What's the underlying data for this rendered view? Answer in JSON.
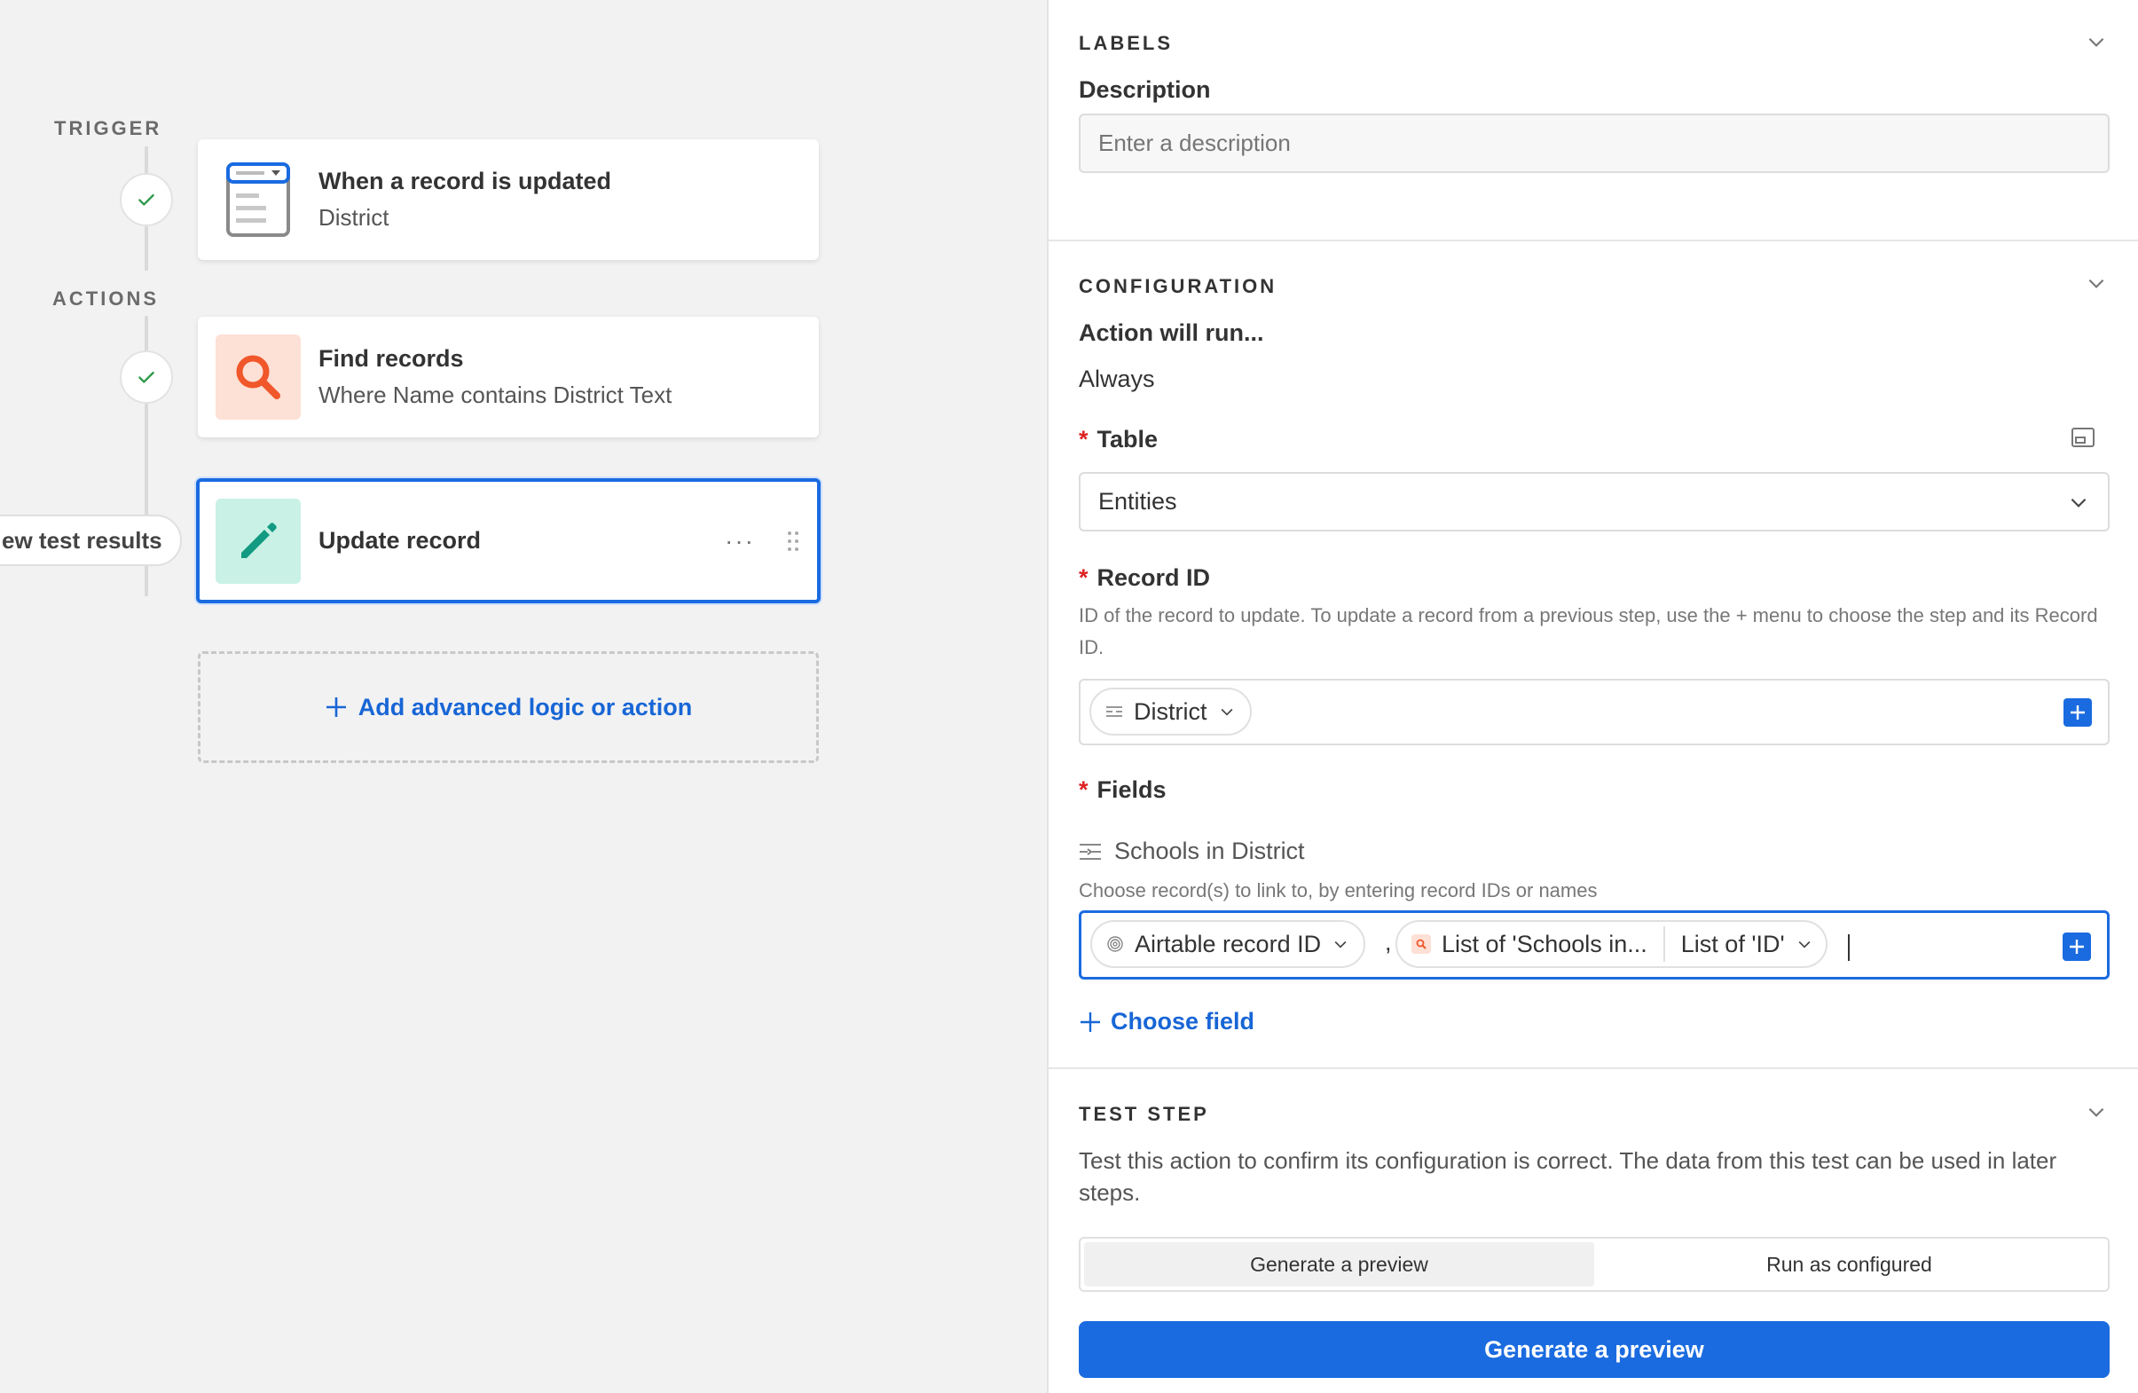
{
  "canvas": {
    "trigger_label": "TRIGGER",
    "actions_label": "ACTIONS",
    "trigger_card": {
      "title": "When a record is updated",
      "subtitle": "District"
    },
    "find_card": {
      "title": "Find records",
      "subtitle": "Where Name contains District Text"
    },
    "update_card": {
      "title": "Update record"
    },
    "test_results_button": "ew test results",
    "add_logic_label": "Add advanced logic or action"
  },
  "panel": {
    "labels_section": {
      "heading": "LABELS",
      "description_label": "Description",
      "description_placeholder": "Enter a description"
    },
    "configuration_section": {
      "heading": "CONFIGURATION",
      "action_will_run_label": "Action will run...",
      "action_will_run_value": "Always",
      "table_label": "Table",
      "table_value": "Entities",
      "record_id_label": "Record ID",
      "record_id_help": "ID of the record to update. To update a record from a previous step, use the + menu to choose the step and its Record ID.",
      "record_id_chip": "District",
      "fields_label": "Fields",
      "field_name": "Schools in District",
      "field_help": "Choose record(s) to link to, by entering record IDs or names",
      "token_airtable": "Airtable record ID",
      "token_separator": ",",
      "token_list": "List of 'Schools in...",
      "token_list_of_id": "List of 'ID'",
      "choose_field_label": "Choose field"
    },
    "test_step_section": {
      "heading": "TEST STEP",
      "description": "Test this action to confirm its configuration is correct. The data from this test can be used in later steps.",
      "seg_generate": "Generate a preview",
      "seg_run": "Run as configured",
      "primary_button": "Generate a preview"
    }
  },
  "colors": {
    "accent": "#1a6be0",
    "find_icon_bg": "#fde0d6",
    "find_icon_fg": "#f0572a",
    "update_icon_bg": "#c9f1e6",
    "update_icon_fg": "#129a82",
    "required": "#dd2222"
  }
}
